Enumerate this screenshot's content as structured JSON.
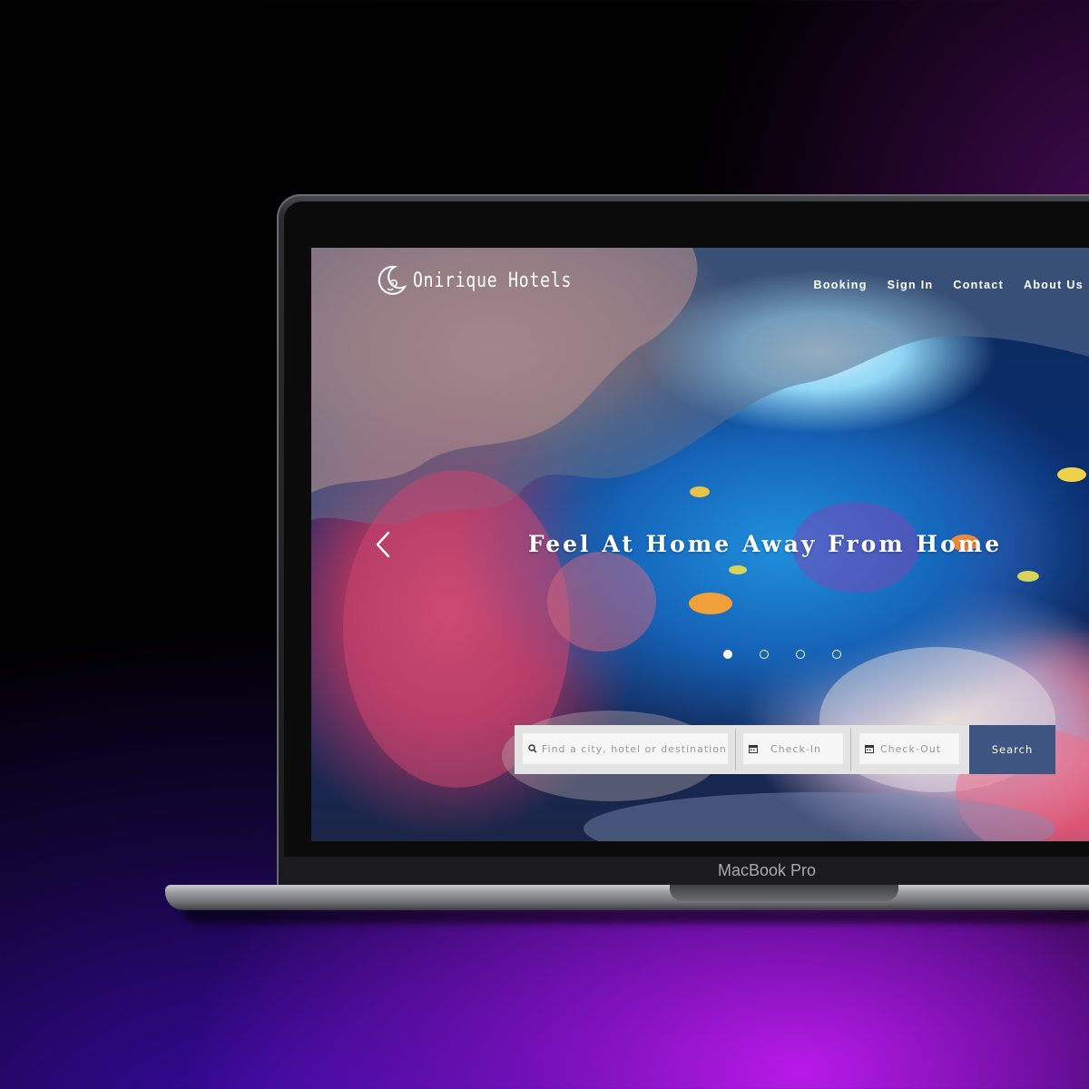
{
  "device": {
    "label": "MacBook Pro"
  },
  "site": {
    "logo_text": "Onirique Hotels",
    "nav": [
      {
        "label": "Booking"
      },
      {
        "label": "Sign In"
      },
      {
        "label": "Contact"
      },
      {
        "label": "About Us"
      }
    ],
    "hero": {
      "title": "Feel At Home Away From Home",
      "slides_total": 4,
      "active_slide": 1
    },
    "search": {
      "destination_placeholder": "Find a city, hotel or destination",
      "checkin_placeholder": "Check-In",
      "checkout_placeholder": "Check-Out",
      "button_label": "Search"
    }
  },
  "colors": {
    "search_button": "#3f5581",
    "search_bar": "#e3e3e3",
    "text_white": "#ffffff"
  },
  "icons": {
    "logo": "crescent-moon-swirl-icon",
    "prev": "chevron-left-icon",
    "destination": "search-icon",
    "checkin": "calendar-icon",
    "checkout": "calendar-icon"
  }
}
